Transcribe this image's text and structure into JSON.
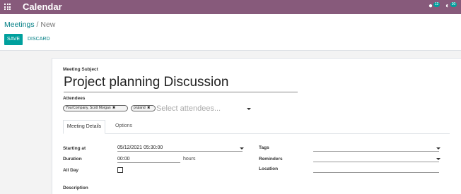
{
  "navbar": {
    "app_title": "Calendar",
    "apps_icon": "apps-grid-icon",
    "messages": {
      "icon": "chat-icon",
      "badge": "12"
    },
    "activities": {
      "icon": "clock-icon",
      "badge": "30"
    },
    "color": "#875a7b"
  },
  "breadcrumb": {
    "parent": "Meetings",
    "separator": "/",
    "current": "New"
  },
  "toolbar": {
    "save_label": "SAVE",
    "discard_label": "DISCARD",
    "accent": "#00a09d"
  },
  "form": {
    "subject_label": "Meeting Subject",
    "subject_value": "Project planning Discussion",
    "attendees_label": "Attendees",
    "attendees": [
      {
        "name": "YourCompany, Scott Morgan"
      },
      {
        "name": "pruland"
      }
    ],
    "attendees_placeholder": "Select attendees...",
    "tabs": [
      {
        "label": "Meeting Details",
        "active": true
      },
      {
        "label": "Options",
        "active": false
      }
    ],
    "details": {
      "starting_at_label": "Starting at",
      "starting_at_value": "05/12/2021 05:30:00",
      "duration_label": "Duration",
      "duration_value": "00:00",
      "duration_unit": "hours",
      "all_day_label": "All Day",
      "all_day_checked": false,
      "tags_label": "Tags",
      "reminders_label": "Reminders",
      "location_label": "Location",
      "description_label": "Description"
    }
  }
}
